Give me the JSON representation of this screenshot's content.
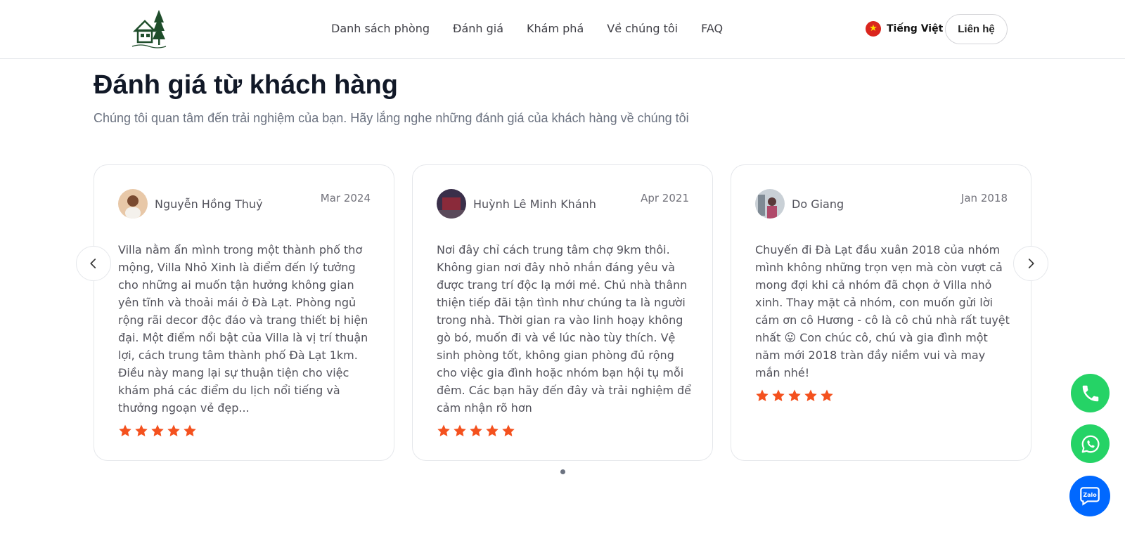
{
  "header": {
    "logo_icon": "villa-house-tree-logo",
    "nav": [
      "Danh sách phòng",
      "Đánh giá",
      "Khám phá",
      "Về chúng tôi",
      "FAQ"
    ],
    "language": {
      "flag": "vietnam-flag-icon",
      "label": "Tiếng Việt"
    },
    "contact_label": "Liên hệ"
  },
  "section": {
    "title": "Đánh giá từ khách hàng",
    "subtitle": "Chúng tôi quan tâm đến trải nghiệm của bạn. Hãy lắng nghe những đánh giá của khách hàng về chúng tôi"
  },
  "reviews": [
    {
      "name": "Nguyễn Hồng Thuỷ",
      "date": "Mar 2024",
      "text": "Villa nằm ẩn mình trong một thành phố thơ mộng, Villa Nhỏ Xinh là điểm đến lý tưởng cho những ai muốn tận hưởng không gian yên tĩnh và thoải mái ở Đà Lạt. Phòng ngủ rộng rãi decor độc đáo và trang thiết bị hiện đại. Một điểm nổi bật của Villa là vị trí thuận lợi, cách trung tâm thành phố Đà Lạt 1km. Điều này mang lại sự thuận tiện cho việc khám phá các điểm du lịch nổi tiếng và thưởng ngoạn vẻ đẹp...",
      "rating": 5
    },
    {
      "name": "Huỳnh Lê Minh Khánh",
      "date": "Apr 2021",
      "text": "Nơi đây chỉ cách trung tâm chợ 9km thôi. Không gian nơi đây nhỏ nhắn đáng yêu và được trang trí độc lạ mới mẻ. Chủ nhà thânn thiện tiếp đãi tận tình như chúng ta là người trong nhà. Thời gian ra vào linh hoạy không gò bó, muốn đi và về lúc nào tùy thích. Vệ sinh phòng tốt, không gian phòng đủ rộng cho việc gia đình hoặc nhóm bạn hội tụ mỗi đêm. Các bạn hãy đến đây và trải nghiệm để cảm nhận rõ hơn",
      "rating": 5
    },
    {
      "name": "Do Giang",
      "date": "Jan 2018",
      "text": "Chuyến đi Đà Lạt đầu xuân 2018 của nhóm mình không những trọn vẹn mà còn vượt cả mong đợi khi cả nhóm đã chọn ở Villa nhỏ xinh. Thay mặt cả nhóm, con muốn gửi lời cảm ơn cô Hương - cô là cô chủ nhà rất tuyệt nhất 😛 Con chúc cô, chú và gia đình một năm mới 2018 tràn đầy niềm vui và may mắn nhé!",
      "rating": 5
    }
  ],
  "colors": {
    "star": "#f4511e",
    "phone": "#25d366",
    "whatsapp": "#25d366",
    "zalo": "#0068ff"
  },
  "floating": {
    "phone_icon": "phone-icon",
    "whatsapp_icon": "whatsapp-icon",
    "zalo_label": "Zalo"
  }
}
